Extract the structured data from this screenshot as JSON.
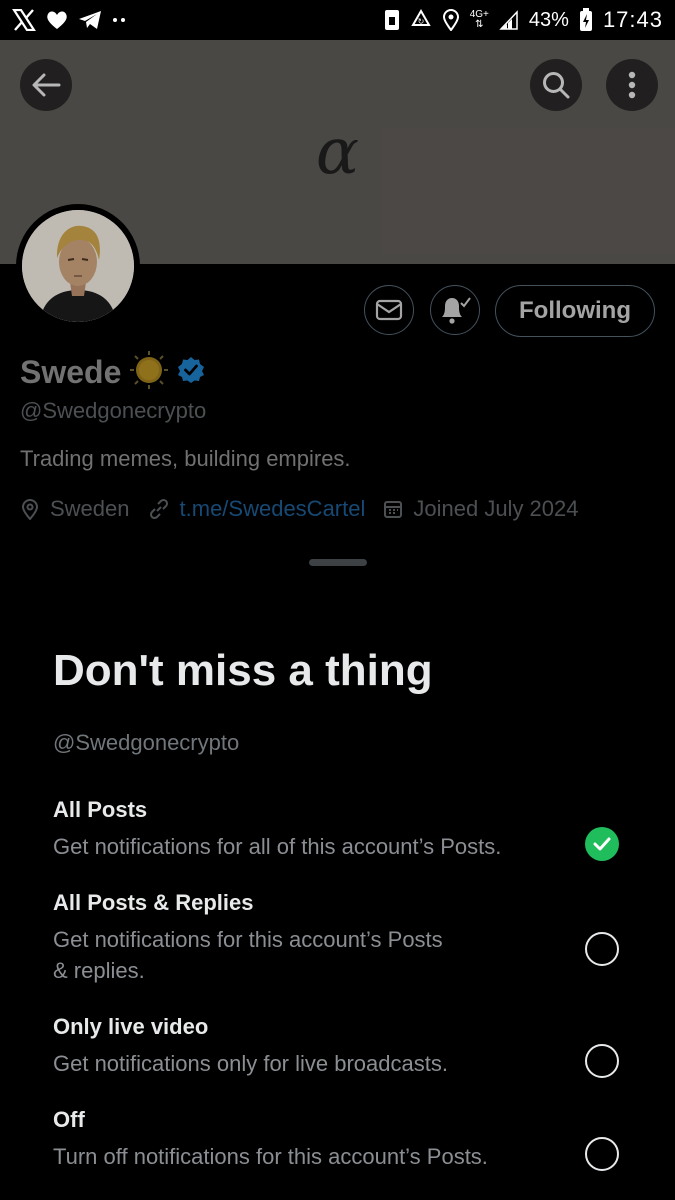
{
  "status_bar": {
    "network": "4G+",
    "battery_percent": "43%",
    "time": "17:43",
    "left_icons": [
      "x-logo-icon",
      "heart-icon",
      "telegram-icon",
      "more-dots-icon"
    ],
    "right_icons": [
      "storage-icon",
      "recycle-icon",
      "location-icon",
      "signal-icon",
      "battery-icon"
    ]
  },
  "header": {
    "banner_logo": "α",
    "back_icon": "arrow-left-icon",
    "search_icon": "search-icon",
    "more_icon": "vertical-dots-icon"
  },
  "profile": {
    "display_name": "Swede",
    "handle": "@Swedgonecrypto",
    "bio": "Trading memes, building empires.",
    "location": "Sweden",
    "website": "t.me/SwedesCartel",
    "joined": "Joined July 2024",
    "following_label": "Following",
    "verified": true
  },
  "sheet": {
    "title": "Don't miss a thing",
    "handle": "@Swedgonecrypto",
    "options": [
      {
        "title": "All Posts",
        "description": "Get notifications for all of this account’s Posts.",
        "selected": true
      },
      {
        "title": "All Posts & Replies",
        "description": "Get notifications for this account’s Posts & replies.",
        "selected": false
      },
      {
        "title": "Only live video",
        "description": "Get notifications only for live broadcasts.",
        "selected": false
      },
      {
        "title": "Off",
        "description": "Turn off notifications for this account’s Posts.",
        "selected": false
      }
    ]
  },
  "colors": {
    "background": "#000000",
    "banner": "#5b5854",
    "check_green": "#1fbd5c",
    "verified_blue": "#1d9bf0",
    "link_blue": "#1d5a8e"
  }
}
